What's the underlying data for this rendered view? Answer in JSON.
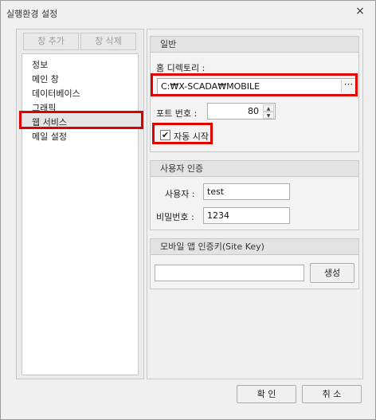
{
  "window": {
    "title": "실행환경 설정",
    "close_label": "×"
  },
  "left": {
    "add_label": "창 추가",
    "delete_label": "창 삭제",
    "tree": [
      "정보",
      "메인 창",
      "데이터베이스",
      "그래픽",
      "웹 서비스",
      "메일 설정"
    ],
    "selected_index": 4
  },
  "general": {
    "header": "일반",
    "home_dir_label": "홈 디렉토리 :",
    "home_dir_value": "C:₩X-SCADA₩MOBILE",
    "browse_label": "···",
    "port_label": "포트 번호 :",
    "port_value": "80",
    "autostart_label": "자동 시작",
    "autostart_checked": true
  },
  "auth": {
    "header": "사용자 인증",
    "user_label": "사용자 :",
    "user_value": "test",
    "password_label": "비밀번호 :",
    "password_value": "1234"
  },
  "sitekey": {
    "header": "모바일 앱 인증키(Site Key)",
    "value": "",
    "generate_label": "생성"
  },
  "footer": {
    "ok_label": "확 인",
    "cancel_label": "취 소"
  }
}
